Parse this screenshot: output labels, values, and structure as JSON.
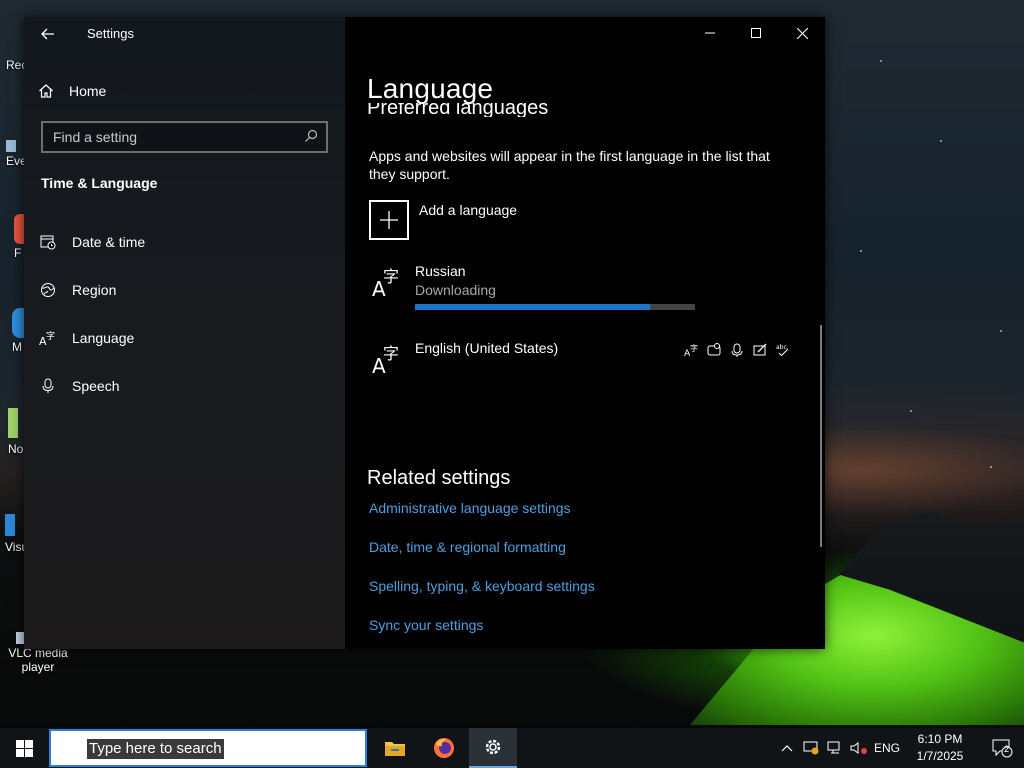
{
  "desktop": {
    "icons": [
      {
        "label": "Rec"
      },
      {
        "label": "Eve"
      },
      {
        "label": "F"
      },
      {
        "label": "M"
      },
      {
        "label": "No"
      },
      {
        "label": "Visu"
      },
      {
        "label": "VLC media player"
      }
    ]
  },
  "window": {
    "title": "Settings",
    "controls": {
      "minimize": "minimize",
      "maximize": "maximize",
      "close": "close"
    }
  },
  "sidebar": {
    "home_label": "Home",
    "search_placeholder": "Find a setting",
    "section": "Time & Language",
    "items": [
      {
        "label": "Date & time",
        "icon": "calendar-clock-icon"
      },
      {
        "label": "Region",
        "icon": "globe-icon"
      },
      {
        "label": "Language",
        "icon": "language-icon"
      },
      {
        "label": "Speech",
        "icon": "microphone-icon"
      }
    ]
  },
  "main": {
    "title": "Language",
    "clipped_heading": "Preferred languages",
    "description": "Apps and websites will appear in the first language in the list that they support.",
    "add_language_label": "Add a language",
    "languages": [
      {
        "name": "Russian",
        "status": "Downloading",
        "progress": 0.84
      },
      {
        "name": "English (United States)",
        "features": [
          "display-language-icon",
          "speech-recognition-icon",
          "text-to-speech-icon",
          "handwriting-icon",
          "spell-check-icon"
        ]
      }
    ],
    "related_heading": "Related settings",
    "related_links": [
      "Administrative language settings",
      "Date, time & regional formatting",
      "Spelling, typing, & keyboard settings",
      "Sync your settings"
    ]
  },
  "taskbar": {
    "search_placeholder": "Type here to search",
    "apps": [
      "file-explorer",
      "firefox",
      "settings"
    ],
    "tray": {
      "language": "ENG",
      "time": "6:10 PM",
      "date": "1/7/2025",
      "notification_count": "2"
    }
  },
  "colors": {
    "accent": "#1e74c8",
    "link": "#4d9fe0",
    "tent": "#6ddc2a"
  }
}
